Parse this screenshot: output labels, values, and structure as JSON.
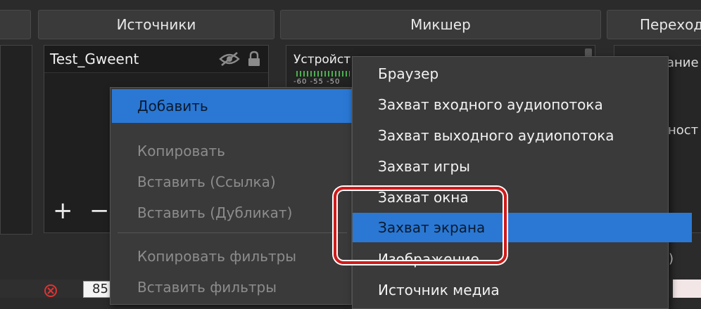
{
  "panels": {
    "sources_title": "Источники",
    "mixer_title": "Микшер",
    "transitions_title": "Переход"
  },
  "sources": {
    "items": [
      {
        "name": "Test_Gweent"
      }
    ],
    "add_button": "+",
    "remove_button": "−"
  },
  "mixer": {
    "device_label": "Устройст",
    "meter_ticks": "-60 -55 -50"
  },
  "transitions": {
    "text_1": "ание",
    "text_2": "ност",
    "text_3": ")"
  },
  "context_menu": {
    "items": [
      {
        "label": "Добавить",
        "state": "active",
        "has_submenu": true
      },
      {
        "label": "Копировать",
        "state": "disabled"
      },
      {
        "label": "Вставить (Ссылка)",
        "state": "disabled"
      },
      {
        "label": "Вставить (Дубликат)",
        "state": "disabled"
      },
      {
        "label": "Копировать фильтры",
        "state": "disabled"
      },
      {
        "label": "Вставить фильтры",
        "state": "disabled"
      }
    ],
    "submenu_arrow": "▶"
  },
  "submenu": {
    "items": [
      {
        "label": "Браузер"
      },
      {
        "label": "Захват входного аудиопотока"
      },
      {
        "label": "Захват выходного аудиопотока"
      },
      {
        "label": "Захват игры"
      },
      {
        "label": "Захват окна"
      },
      {
        "label": "Захват экрана",
        "state": "active"
      },
      {
        "label": "Изображение"
      },
      {
        "label": "Источник медиа"
      }
    ]
  },
  "bottom": {
    "partial_number": "85"
  },
  "colors": {
    "highlight": "#2a78d4",
    "annotation_ring": "#d11a1a"
  }
}
